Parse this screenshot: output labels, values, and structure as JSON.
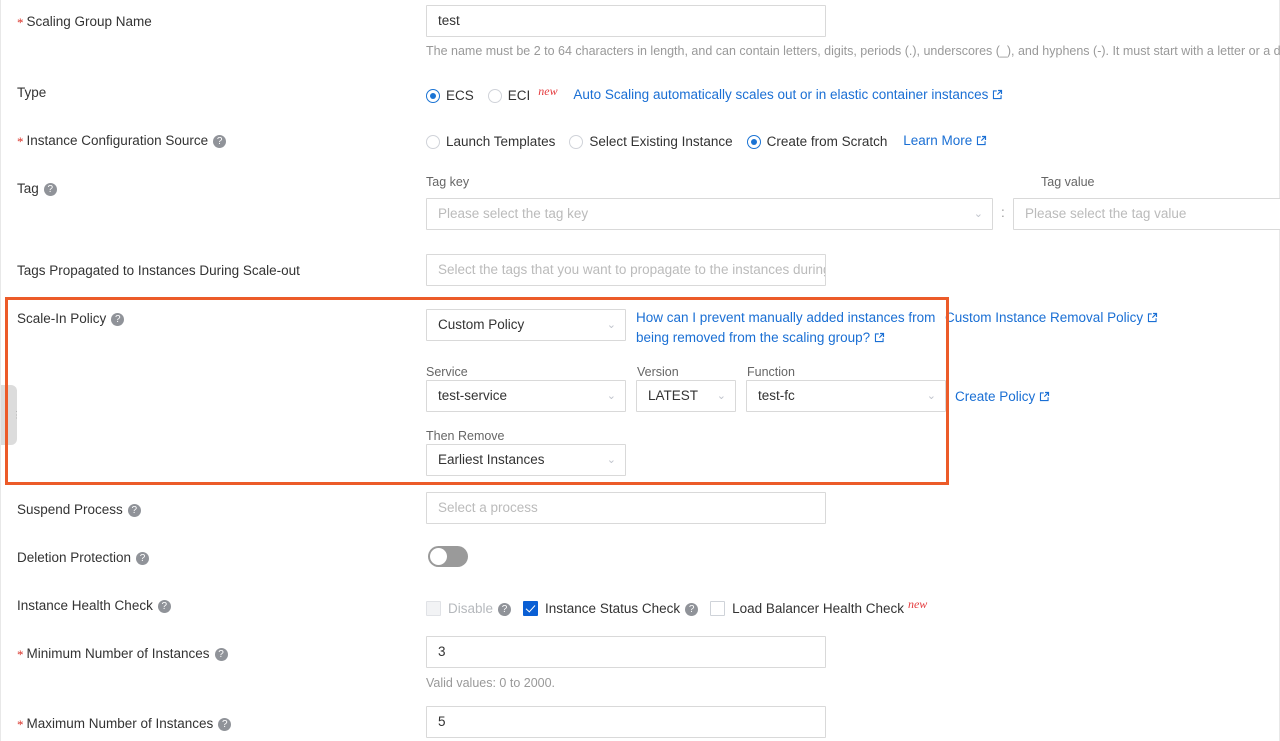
{
  "theme": {
    "accent_blue": "#1a6fd4",
    "highlight_orange": "#ec5b29",
    "required_red": "#d93026",
    "new_badge_red": "#e4393c"
  },
  "form": {
    "scaling_group_name": {
      "label": "Scaling Group Name",
      "required": true,
      "value": "test",
      "hint": "The name must be 2 to 64 characters in length, and can contain letters, digits, periods (.), underscores (_), and hyphens (-). It must start with a letter or a digit."
    },
    "type": {
      "label": "Type",
      "options": [
        {
          "label": "ECS",
          "selected": true
        },
        {
          "label": "ECI",
          "selected": false,
          "badge": "new"
        }
      ],
      "link": "Auto Scaling automatically scales out or in elastic container instances"
    },
    "instance_configuration_source": {
      "label": "Instance Configuration Source",
      "required": true,
      "options": [
        {
          "label": "Launch Templates",
          "selected": false
        },
        {
          "label": "Select Existing Instance",
          "selected": false
        },
        {
          "label": "Create from Scratch",
          "selected": true
        }
      ],
      "link": "Learn More"
    },
    "tag": {
      "label": "Tag",
      "key_label": "Tag key",
      "key_placeholder": "Please select the tag key",
      "separator": ":",
      "value_label": "Tag value",
      "value_placeholder": "Please select the tag value"
    },
    "tags_propagated": {
      "label": "Tags Propagated to Instances During Scale-out",
      "placeholder": "Select the tags that you want to propagate to the instances during sc..."
    },
    "scale_in_policy": {
      "label": "Scale-In Policy",
      "policy_value": "Custom Policy",
      "help_link": "How can I prevent manually added instances from being removed from the scaling group?",
      "removal_policy_link": "Custom Instance Removal Policy",
      "service_label": "Service",
      "service_value": "test-service",
      "version_label": "Version",
      "version_value": "LATEST",
      "function_label": "Function",
      "function_value": "test-fc",
      "create_policy_link": "Create Policy",
      "then_remove_label": "Then Remove",
      "then_remove_value": "Earliest Instances"
    },
    "suspend_process": {
      "label": "Suspend Process",
      "placeholder": "Select a process"
    },
    "deletion_protection": {
      "label": "Deletion Protection",
      "enabled": false
    },
    "instance_health_check": {
      "label": "Instance Health Check",
      "options": [
        {
          "label": "Disable",
          "checked": false,
          "disabled": true,
          "help": true
        },
        {
          "label": "Instance Status Check",
          "checked": true,
          "disabled": false,
          "help": true
        },
        {
          "label": "Load Balancer Health Check",
          "checked": false,
          "disabled": false,
          "badge": "new"
        }
      ]
    },
    "minimum_instances": {
      "label": "Minimum Number of Instances",
      "required": true,
      "value": "3",
      "hint": "Valid values: 0 to 2000."
    },
    "maximum_instances": {
      "label": "Maximum Number of Instances",
      "required": true,
      "value": "5"
    }
  }
}
